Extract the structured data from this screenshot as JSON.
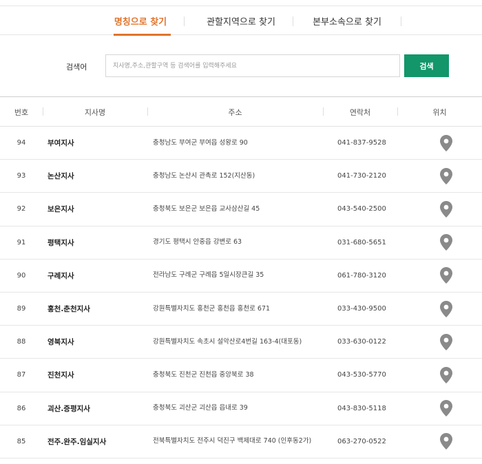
{
  "tabs": [
    {
      "label": "명칭으로 찾기",
      "active": true
    },
    {
      "label": "관할지역으로 찾기",
      "active": false
    },
    {
      "label": "본부소속으로 찾기",
      "active": false
    }
  ],
  "search": {
    "label": "검색어",
    "placeholder": "지사명,주소,관할구역 등 검색어를 입력해주세요",
    "value": "",
    "button": "검색"
  },
  "table": {
    "headers": [
      "번호",
      "지사명",
      "주소",
      "연락처",
      "위치"
    ],
    "rows": [
      {
        "num": "94",
        "name": "부여지사",
        "addr": "충청남도 부여군 부여읍 성왕로 90",
        "phone": "041-837-9528"
      },
      {
        "num": "93",
        "name": "논산지사",
        "addr": "충청남도 논산시 관촉로 152(지산동)",
        "phone": "041-730-2120"
      },
      {
        "num": "92",
        "name": "보은지사",
        "addr": "충청북도 보은군 보은읍 교사삼산길 45",
        "phone": "043-540-2500"
      },
      {
        "num": "91",
        "name": "평택지사",
        "addr": "경기도 평택시 안중읍 강변로 63",
        "phone": "031-680-5651"
      },
      {
        "num": "90",
        "name": "구례지사",
        "addr": "전라남도 구례군 구례읍 5일시장큰길 35",
        "phone": "061-780-3120"
      },
      {
        "num": "89",
        "name": "홍천.춘천지사",
        "addr": "강원특별자치도 홍천군 홍천읍 홍천로 671",
        "phone": "033-430-9500"
      },
      {
        "num": "88",
        "name": "영북지사",
        "addr": "강원특별자치도 속초시 설악산로4번길 163-4(대포동)",
        "phone": "033-630-0122"
      },
      {
        "num": "87",
        "name": "진천지사",
        "addr": "충청북도 진천군 진천읍 중앙북로 38",
        "phone": "043-530-5770"
      },
      {
        "num": "86",
        "name": "괴산.증평지사",
        "addr": "충청북도 괴산군 괴산읍 읍내로 39",
        "phone": "043-830-5118"
      },
      {
        "num": "85",
        "name": "전주.완주.임실지사",
        "addr": "전북특별자치도 전주시 덕진구 백제대로 740 (인후동2가)",
        "phone": "063-270-0522"
      }
    ]
  },
  "icons": {
    "location": "map-pin-icon"
  },
  "colors": {
    "accent": "#e0742b",
    "button": "#12966a",
    "pin": "#8a8a8a"
  }
}
